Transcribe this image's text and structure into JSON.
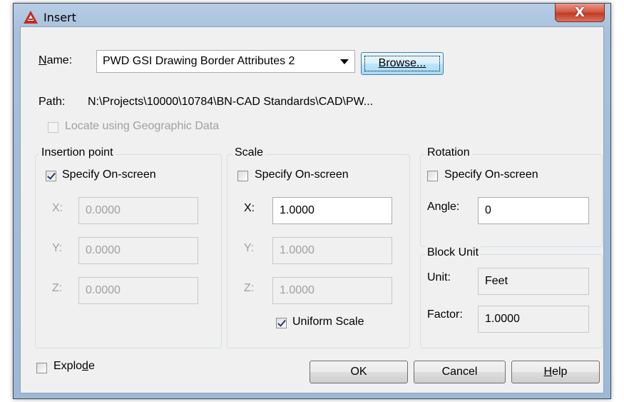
{
  "window": {
    "title": "Insert",
    "close_label": "X",
    "accent_color": "#c42b1c"
  },
  "name": {
    "label": "Name:",
    "value": "PWD GSI Drawing Border Attributes 2",
    "browse_label": "Browse..."
  },
  "path": {
    "label": "Path:",
    "value": "N:\\Projects\\10000\\10784\\BN-CAD Standards\\CAD\\PW..."
  },
  "geo": {
    "label": "Locate using Geographic Data",
    "checked": false,
    "enabled": false
  },
  "insertion": {
    "title": "Insertion point",
    "specify_label": "Specify On-screen",
    "specify_checked": true,
    "x_label": "X:",
    "x_value": "0.0000",
    "y_label": "Y:",
    "y_value": "0.0000",
    "z_label": "Z:",
    "z_value": "0.0000"
  },
  "scale": {
    "title": "Scale",
    "specify_label": "Specify On-screen",
    "specify_checked": false,
    "x_label": "X:",
    "x_value": "1.0000",
    "y_label": "Y:",
    "y_value": "1.0000",
    "z_label": "Z:",
    "z_value": "1.0000",
    "uniform_label": "Uniform Scale",
    "uniform_checked": true
  },
  "rotation": {
    "title": "Rotation",
    "specify_label": "Specify On-screen",
    "specify_checked": false,
    "angle_label": "Angle:",
    "angle_value": "0"
  },
  "block_unit": {
    "title": "Block Unit",
    "unit_label": "Unit:",
    "unit_value": "Feet",
    "factor_label": "Factor:",
    "factor_value": "1.0000"
  },
  "explode": {
    "label": "Explode",
    "checked": false
  },
  "buttons": {
    "ok": "OK",
    "cancel": "Cancel",
    "help": "Help"
  }
}
